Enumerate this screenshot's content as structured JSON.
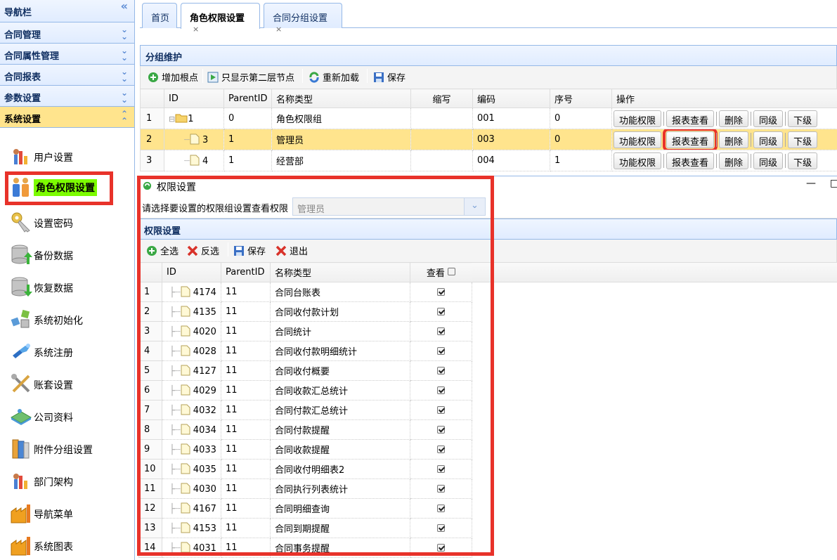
{
  "sidebar": {
    "title": "导航栏",
    "sections": [
      {
        "label": "合同管理"
      },
      {
        "label": "合同属性管理"
      },
      {
        "label": "合同报表"
      },
      {
        "label": "参数设置"
      },
      {
        "label": "系统设置"
      }
    ],
    "items": [
      {
        "label": "用户设置",
        "icon": "users-chart-icon"
      },
      {
        "label": "角色权限设置",
        "icon": "role-users-icon"
      },
      {
        "label": "设置密码",
        "icon": "key-icon"
      },
      {
        "label": "备份数据",
        "icon": "database-backup-icon"
      },
      {
        "label": "恢复数据",
        "icon": "database-restore-icon"
      },
      {
        "label": "系统初始化",
        "icon": "cubes-icon"
      },
      {
        "label": "系统注册",
        "icon": "wrench-register-icon"
      },
      {
        "label": "账套设置",
        "icon": "tools-icon"
      },
      {
        "label": "公司资料",
        "icon": "book-icon"
      },
      {
        "label": "附件分组设置",
        "icon": "folder-books-icon"
      },
      {
        "label": "部门架构",
        "icon": "department-chart-icon"
      },
      {
        "label": "导航菜单",
        "icon": "factory-icon"
      },
      {
        "label": "系统图表",
        "icon": "factory-chart-icon"
      }
    ]
  },
  "tabs": [
    {
      "label": "首页"
    },
    {
      "label": "角色权限设置",
      "close": "×"
    },
    {
      "label": "合同分组设置",
      "close": "×"
    }
  ],
  "main": {
    "title": "分组维护",
    "toolbar": {
      "add_root": "增加根点",
      "show_second": "只显示第二层节点",
      "reload": "重新加载",
      "save": "保存"
    },
    "columns": [
      "ID",
      "ParentID",
      "名称类型",
      "缩写",
      "编码",
      "序号",
      "操作"
    ],
    "rows": [
      {
        "rn": "1",
        "id": "1",
        "parent": "0",
        "name": "角色权限组",
        "abbr": "",
        "code": "001",
        "seq": "0"
      },
      {
        "rn": "2",
        "id": "3",
        "parent": "1",
        "name": "管理员",
        "abbr": "",
        "code": "003",
        "seq": "0"
      },
      {
        "rn": "3",
        "id": "4",
        "parent": "1",
        "name": "经营部",
        "abbr": "",
        "code": "004",
        "seq": "1"
      }
    ],
    "ops": {
      "func": "功能权限",
      "report": "报表查看",
      "delete": "删除",
      "same": "同级",
      "lower": "下级"
    }
  },
  "dialog": {
    "title": "权限设置",
    "min": "—",
    "max": "□",
    "select_label": "请选择要设置的权限组设置查看权限",
    "select_value": "管理员",
    "panel_title": "权限设置",
    "toolbar": {
      "all": "全选",
      "invert": "反选",
      "save": "保存",
      "exit": "退出"
    },
    "columns": [
      "ID",
      "ParentID",
      "名称类型",
      "查看"
    ],
    "rows": [
      {
        "rn": "1",
        "id": "4174",
        "parent": "11",
        "name": "合同台账表"
      },
      {
        "rn": "2",
        "id": "4135",
        "parent": "11",
        "name": "合同收付款计划"
      },
      {
        "rn": "3",
        "id": "4020",
        "parent": "11",
        "name": "合同统计"
      },
      {
        "rn": "4",
        "id": "4028",
        "parent": "11",
        "name": "合同收付款明细统计"
      },
      {
        "rn": "5",
        "id": "4127",
        "parent": "11",
        "name": "合同收付概要"
      },
      {
        "rn": "6",
        "id": "4029",
        "parent": "11",
        "name": "合同收款汇总统计"
      },
      {
        "rn": "7",
        "id": "4032",
        "parent": "11",
        "name": "合同付款汇总统计"
      },
      {
        "rn": "8",
        "id": "4034",
        "parent": "11",
        "name": "合同付款提醒"
      },
      {
        "rn": "9",
        "id": "4033",
        "parent": "11",
        "name": "合同收款提醒"
      },
      {
        "rn": "10",
        "id": "4035",
        "parent": "11",
        "name": "合同收付明细表2"
      },
      {
        "rn": "11",
        "id": "4030",
        "parent": "11",
        "name": "合同执行列表统计"
      },
      {
        "rn": "12",
        "id": "4167",
        "parent": "11",
        "name": "合同明细查询"
      },
      {
        "rn": "13",
        "id": "4153",
        "parent": "11",
        "name": "合同到期提醒"
      },
      {
        "rn": "14",
        "id": "4031",
        "parent": "11",
        "name": "合同事务提醒"
      }
    ]
  },
  "colors": {
    "highlight_red": "#e8322a",
    "selected_row": "#ffe48d",
    "border_blue": "#95b8e7",
    "label_green": "#7cfc00"
  }
}
